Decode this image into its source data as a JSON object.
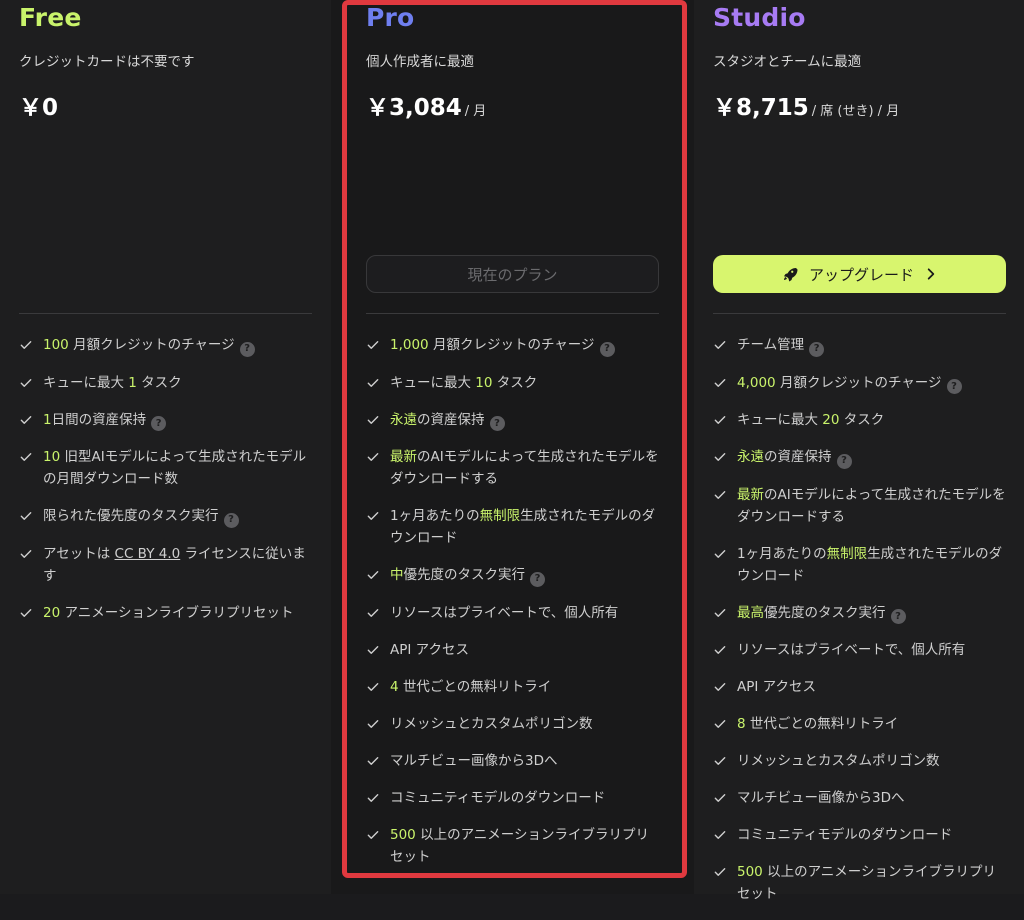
{
  "plans": {
    "free": {
      "name": "Free",
      "description": "クレジットカードは不要です",
      "price": "￥0",
      "features": [
        {
          "hl": "100",
          "text": " 月額クレジットのチャージ",
          "help": "?"
        },
        {
          "pre": "キューに最大 ",
          "hl": "1",
          "post": " タスク"
        },
        {
          "hl": "1",
          "text": "日間の資産保持",
          "help": "?"
        },
        {
          "hl": "10",
          "text": " 旧型AIモデルによって生成されたモデルの月間ダウンロード数"
        },
        {
          "text": "限られた優先度のタスク実行",
          "help": "?"
        },
        {
          "pre": "アセットは ",
          "link": "CC BY 4.0",
          "post": " ライセンスに従います"
        },
        {
          "hl": "20",
          "text": " アニメーションライブラリプリセット"
        }
      ]
    },
    "pro": {
      "name": "Pro",
      "description": "個人作成者に最適",
      "price": "￥3,084",
      "unit": "/ 月",
      "button": "現在のプラン",
      "features": [
        {
          "hl": "1,000",
          "text": " 月額クレジットのチャージ",
          "help": "?"
        },
        {
          "pre": "キューに最大 ",
          "hl": "10",
          "post": " タスク"
        },
        {
          "hl": "永遠",
          "text": "の資産保持",
          "help": "?"
        },
        {
          "hl": "最新",
          "text": "のAIモデルによって生成されたモデルをダウンロードする"
        },
        {
          "pre": "1ヶ月あたりの",
          "hl": "無制限",
          "post": "生成されたモデルのダウンロード"
        },
        {
          "hl": "中",
          "text": "優先度のタスク実行",
          "help": "?"
        },
        {
          "text": "リソースはプライベートで、個人所有"
        },
        {
          "text": "API アクセス"
        },
        {
          "hl": "4",
          "text": " 世代ごとの無料リトライ"
        },
        {
          "text": "リメッシュとカスタムポリゴン数"
        },
        {
          "text": "マルチビュー画像から3Dへ"
        },
        {
          "text": "コミュニティモデルのダウンロード"
        },
        {
          "hl": "500",
          "text": " 以上のアニメーションライブラリプリセット"
        }
      ]
    },
    "studio": {
      "name": "Studio",
      "description": "スタジオとチームに最適",
      "price": "￥8,715",
      "unit": "/ 席 (せき) / 月",
      "button": "アップグレード",
      "features": [
        {
          "text": "チーム管理",
          "help": "?"
        },
        {
          "hl": "4,000",
          "text": " 月額クレジットのチャージ",
          "help": "?"
        },
        {
          "pre": "キューに最大 ",
          "hl": "20",
          "post": " タスク"
        },
        {
          "hl": "永遠",
          "text": "の資産保持",
          "help": "?"
        },
        {
          "hl": "最新",
          "text": "のAIモデルによって生成されたモデルをダウンロードする"
        },
        {
          "pre": "1ヶ月あたりの",
          "hl": "無制限",
          "post": "生成されたモデルのダウンロード"
        },
        {
          "hl": "最高",
          "text": "優先度のタスク実行",
          "help": "?"
        },
        {
          "text": "リソースはプライベートで、個人所有"
        },
        {
          "text": "API アクセス"
        },
        {
          "hl": "8",
          "text": " 世代ごとの無料リトライ"
        },
        {
          "text": "リメッシュとカスタムポリゴン数"
        },
        {
          "text": "マルチビュー画像から3Dへ"
        },
        {
          "text": "コミュニティモデルのダウンロード"
        },
        {
          "hl": "500",
          "text": " 以上のアニメーションライブラリプリセット"
        }
      ]
    }
  },
  "colors": {
    "accent_green": "#c9f36b",
    "pro_blue": "#6f7ff0",
    "studio_purple": "#a77bf3",
    "highlight_frame": "#e0393f"
  },
  "icons": {
    "feature_check": "check-icon",
    "upgrade_button": "rocket-icon",
    "upgrade_arrow": "chevron-right-icon",
    "help": "help-icon"
  }
}
